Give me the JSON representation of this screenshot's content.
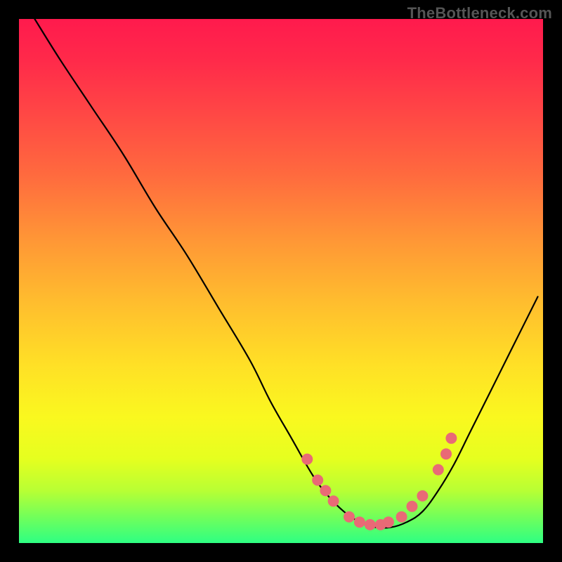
{
  "watermark": "TheBottleneck.com",
  "colors": {
    "curve": "#000000",
    "dots": "#e96a76",
    "frame": "#000000"
  },
  "chart_data": {
    "type": "line",
    "title": "",
    "xlabel": "",
    "ylabel": "",
    "xlim": [
      0,
      100
    ],
    "ylim": [
      0,
      100
    ],
    "grid": false,
    "legend": false,
    "series": [
      {
        "name": "bottleneck-curve",
        "x": [
          3,
          8,
          14,
          20,
          26,
          32,
          38,
          44,
          48,
          52,
          56,
          59,
          62,
          65,
          68,
          71,
          74,
          77,
          80,
          83,
          86,
          90,
          94,
          99
        ],
        "y": [
          100,
          92,
          83,
          74,
          64,
          55,
          45,
          35,
          27,
          20,
          13,
          9,
          6,
          4,
          3,
          3,
          4,
          6,
          10,
          15,
          21,
          29,
          37,
          47
        ]
      }
    ],
    "markers": {
      "name": "highlight-dots",
      "x": [
        55,
        57,
        58.5,
        60,
        63,
        65,
        67,
        69,
        70.5,
        73,
        75,
        77,
        80,
        81.5,
        82.5
      ],
      "y": [
        16,
        12,
        10,
        8,
        5,
        4,
        3.5,
        3.5,
        4,
        5,
        7,
        9,
        14,
        17,
        20
      ]
    }
  }
}
